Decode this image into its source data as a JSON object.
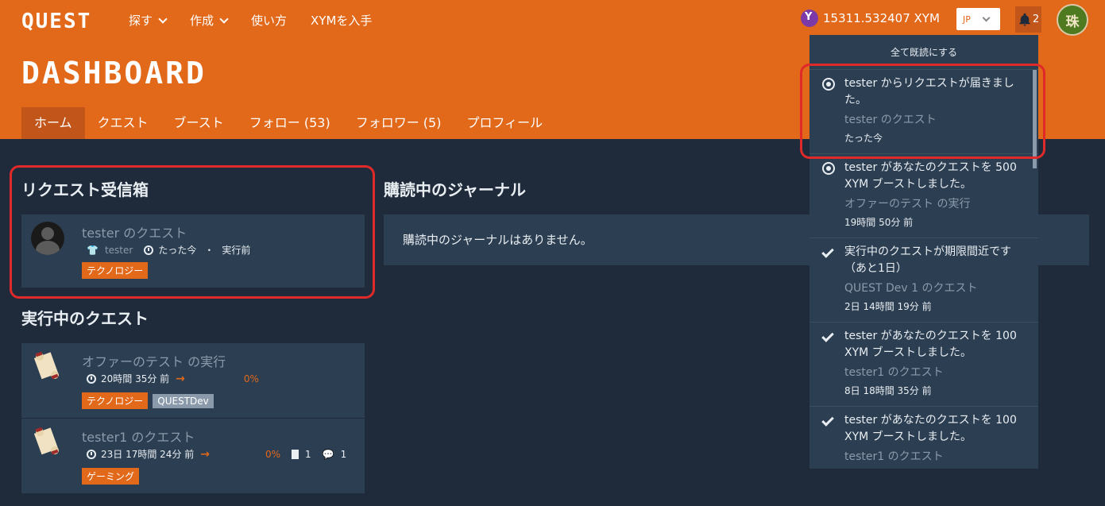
{
  "header": {
    "logo": "QUEST",
    "nav": [
      {
        "label": "探す",
        "dropdown": true
      },
      {
        "label": "作成",
        "dropdown": true
      },
      {
        "label": "使い方",
        "dropdown": false
      },
      {
        "label": "XYMを入手",
        "dropdown": false
      }
    ],
    "title": "DASHBOARD",
    "balance": "15311.532407 XYM",
    "language": "JP",
    "notification_count": "2",
    "avatar_text": "珠",
    "tabs": [
      "ホーム",
      "クエスト",
      "ブースト",
      "フォロー (53)",
      "フォロワー (5)",
      "プロフィール"
    ],
    "active_tab": "ホーム"
  },
  "request_inbox": {
    "title": "リクエスト受信箱",
    "item": {
      "title": "tester のクエスト",
      "user": "tester",
      "time": "たった今",
      "status": "実行前",
      "tag": "テクノロジー"
    }
  },
  "active_quests": {
    "title": "実行中のクエスト",
    "items": [
      {
        "title": "オファーのテスト の実行",
        "time": "20時間 35分 前",
        "progress": "0%",
        "tags": [
          "テクノロジー",
          "QUESTDev"
        ]
      },
      {
        "title": "tester1 のクエスト",
        "time": "23日 17時間 24分 前",
        "progress": "0%",
        "docs": "1",
        "comments": "1",
        "tags": [
          "ゲーミング"
        ]
      }
    ]
  },
  "journal": {
    "title": "購読中のジャーナル",
    "empty": "購読中のジャーナルはありません。"
  },
  "notifications": {
    "mark_all": "全て既読にする",
    "items": [
      {
        "icon": "radio-unread-icon",
        "msg": "tester からリクエストが届きました。",
        "sub": "tester のクエスト",
        "time": "たった今"
      },
      {
        "icon": "radio-unread-icon",
        "msg": "tester があなたのクエストを 500 XYM ブーストしました。",
        "sub": "オファーのテスト の実行",
        "time": "19時間 50分 前"
      },
      {
        "icon": "check-icon",
        "msg": "実行中のクエストが期限間近です（あと1日）",
        "sub": "QUEST Dev 1 のクエスト",
        "time": "2日 14時間 19分 前"
      },
      {
        "icon": "check-icon",
        "msg": "tester があなたのクエストを 100 XYM ブーストしました。",
        "sub": "tester1 のクエスト",
        "time": "8日 18時間 35分 前"
      },
      {
        "icon": "check-icon",
        "msg": "tester があなたのクエストを 100 XYM ブーストしました。",
        "sub": "tester1 のクエスト",
        "time": ""
      }
    ]
  },
  "colors": {
    "accent": "#e2681a",
    "background": "#1f2b3a",
    "card": "#2c3e51",
    "highlight": "#e02a2a"
  }
}
